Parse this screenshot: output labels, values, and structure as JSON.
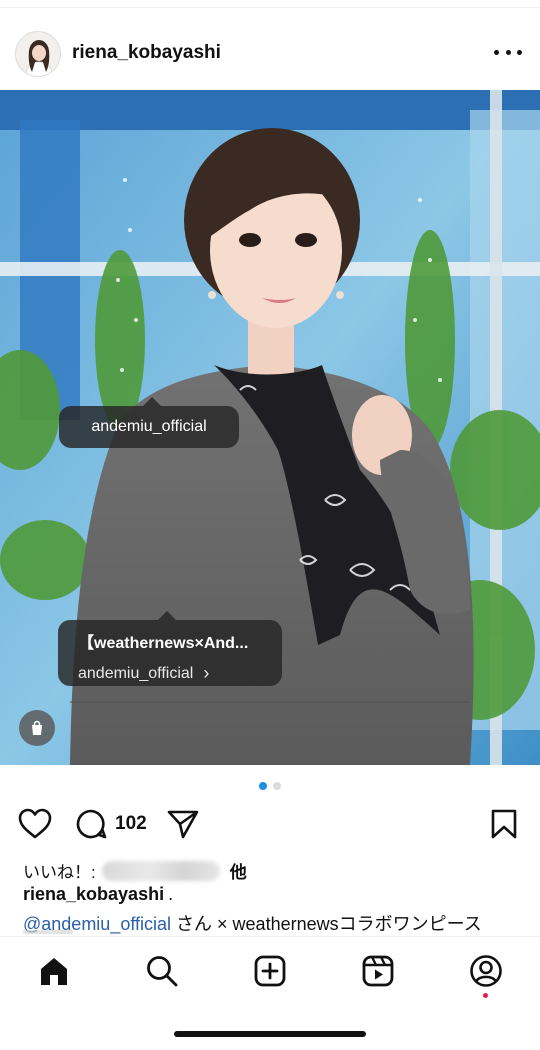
{
  "post": {
    "username": "riena_kobayashi",
    "more_icon": "more-horizontal-icon"
  },
  "tags": {
    "tag1_label": "andemiu_official",
    "tag2_title": "【weathernews×And...",
    "tag2_account": "andemiu_official",
    "tag2_chevron": "›"
  },
  "carousel": {
    "count": 2,
    "active_index": 0
  },
  "actions": {
    "comment_count": "102"
  },
  "caption": {
    "likes_prefix": "いいね！:",
    "likes_suffix": "他",
    "username": "riena_kobayashi",
    "username_suffix": ".",
    "mention": "@andemiu_official",
    "text": " さん × weathernewsコラボワンピース"
  },
  "colors": {
    "accent": "#1a8fe3",
    "mention": "#2a5fa8",
    "notification": "#ed1d49"
  },
  "nav": [
    "home-icon",
    "search-icon",
    "create-icon",
    "reels-icon",
    "profile-icon"
  ]
}
